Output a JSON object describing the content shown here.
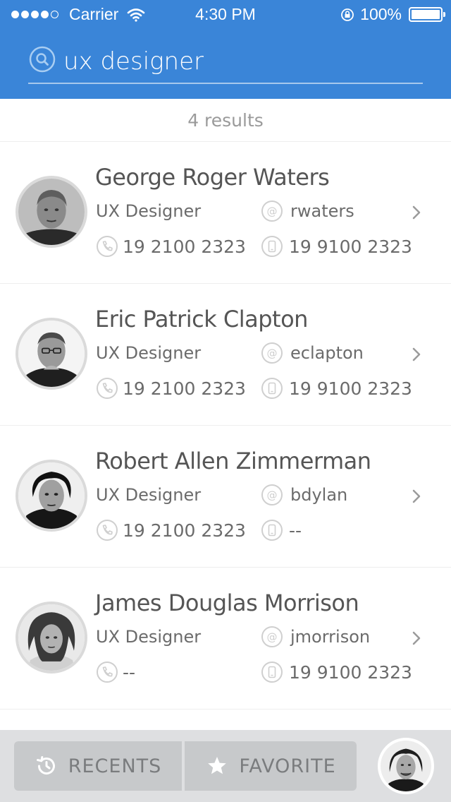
{
  "status_bar": {
    "carrier": "Carrier",
    "time": "4:30 PM",
    "battery": "100%"
  },
  "search": {
    "query": "ux designer"
  },
  "results": {
    "count_label": "4 results"
  },
  "contacts": [
    {
      "name": "George Roger Waters",
      "role": "UX Designer",
      "handle": "rwaters",
      "phone": "19 2100 2323",
      "mobile": "19 9100 2323"
    },
    {
      "name": "Eric Patrick Clapton",
      "role": "UX Designer",
      "handle": "eclapton",
      "phone": "19 2100 2323",
      "mobile": "19 9100 2323"
    },
    {
      "name": "Robert Allen Zimmerman",
      "role": "UX Designer",
      "handle": "bdylan",
      "phone": "19 2100 2323",
      "mobile": "--"
    },
    {
      "name": "James Douglas Morrison",
      "role": "UX Designer",
      "handle": "jmorrison",
      "phone": "--",
      "mobile": "19 9100 2323"
    }
  ],
  "tab_bar": {
    "recents_label": "RECENTS",
    "favorite_label": "FAVORITE"
  },
  "colors": {
    "header_blue": "#3a85d8",
    "text_gray": "#555555",
    "tab_bar_bg": "#dedfe1"
  }
}
